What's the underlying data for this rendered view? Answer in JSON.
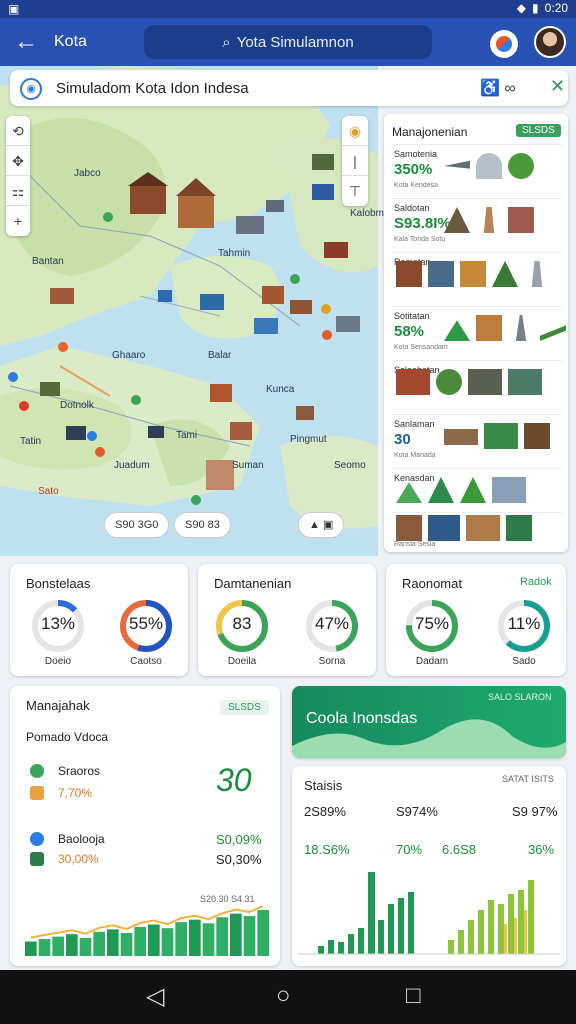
{
  "status": {
    "carrier": "▣",
    "time": "0:20"
  },
  "appbar": {
    "title": "Kota",
    "search": "Yota Simulamnon"
  },
  "map": {
    "header": "Simuladom Kota Idon Indesa",
    "labels": [
      "Jabco",
      "Kalobm",
      "Bantan",
      "Tahmin",
      "Ghaaro",
      "Balar",
      "Kunca",
      "Dotnolk",
      "Tami",
      "Pingmut",
      "Tatin",
      "Juadum",
      "Suman",
      "Seomo",
      "Sato"
    ],
    "pills": [
      "S90 3G0",
      "S90 83",
      "▲ ▣"
    ]
  },
  "side": {
    "title": "Manajonenian",
    "badge": "SLSDS",
    "rows": [
      {
        "label": "Samotenia",
        "value": "350%",
        "sub": "Kota Kendesa"
      },
      {
        "label": "Saldotan",
        "value": "S93.8I%",
        "sub": "Kala Tonda Sotu"
      },
      {
        "label": "Ramatan",
        "value": "",
        "sub": ""
      },
      {
        "label": "Sotitatan",
        "value": "58%",
        "sub": "Kota Sensandam"
      },
      {
        "label": "Saloobatan",
        "value": "",
        "sub": ""
      },
      {
        "label": "Sanlaman",
        "value": "30",
        "sub": "Kota Manada"
      },
      {
        "label": "Kenasdan",
        "value": "",
        "sub": ""
      },
      {
        "label": "",
        "value": "",
        "sub": "Ransla Sesla"
      }
    ]
  },
  "cards": [
    {
      "title": "Bonstelaas",
      "badge": "",
      "donuts": [
        {
          "value": "13%",
          "label": "Doeio"
        },
        {
          "value": "55%",
          "label": "Caotso"
        }
      ]
    },
    {
      "title": "Damtanenian",
      "badge": "",
      "donuts": [
        {
          "value": "83",
          "label": "Doeila"
        },
        {
          "value": "47%",
          "label": "Sorna"
        }
      ]
    },
    {
      "title": "Raonomat",
      "badge": "Radok",
      "donuts": [
        {
          "value": "75%",
          "label": "Dadam"
        },
        {
          "value": "11%",
          "label": "Sado"
        }
      ]
    }
  ],
  "manage": {
    "title": "Manajahak",
    "badge": "SLSDS",
    "subtitle": "Pomado Vdoca",
    "items": [
      {
        "name": "Sraoros",
        "value": "7,70%"
      },
      {
        "name": "Baolooja",
        "value": "30,00%"
      }
    ],
    "big": "30",
    "right1": "S0,09%",
    "right2": "S0,30%",
    "chart_caption": "S20.30  S4.31"
  },
  "banner": {
    "title": "Coola Inonsdas",
    "tag": "SALO SLARON"
  },
  "stats": {
    "title": "Staisis",
    "tag": "SATAT ISITS",
    "row1": [
      "2S89%",
      "S974%",
      "S9 97%"
    ],
    "row2": [
      "18.S6%",
      "70%",
      "6.6S8",
      "36%"
    ]
  },
  "chart_data": {
    "type": "bar",
    "series": [
      {
        "values": [
          12,
          14,
          16,
          18,
          15,
          20,
          22,
          19,
          24,
          26,
          23,
          28,
          30,
          27,
          32,
          35,
          33,
          38
        ]
      }
    ]
  }
}
